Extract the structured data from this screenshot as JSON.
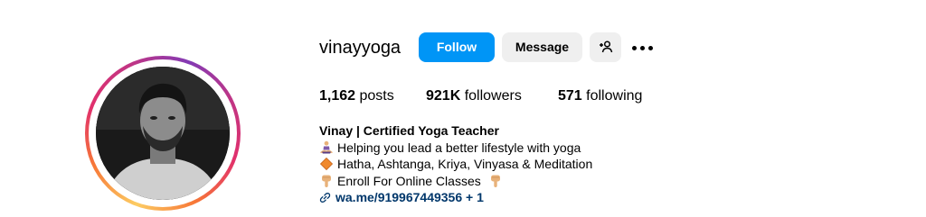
{
  "profile": {
    "username": "vinayyoga",
    "follow_label": "Follow",
    "message_label": "Message",
    "suggest_icon": "person-add-icon",
    "more_icon": "more-options-icon"
  },
  "stats": {
    "posts_count": "1,162",
    "posts_label": "posts",
    "followers_count": "921K",
    "followers_label": "followers",
    "following_count": "571",
    "following_label": "following"
  },
  "bio": {
    "name": "Vinay | Certified Yoga Teacher",
    "lines": [
      {
        "icon": "meditation-emoji",
        "text": "Helping you lead a better lifestyle with yoga"
      },
      {
        "icon": "orange-diamond-emoji",
        "text": "Hatha, Ashtanga, Kriya, Vinyasa & Meditation"
      },
      {
        "icon": "pointing-down-emoji",
        "text": "Enroll For Online Classes",
        "trailing_icon": "pointing-down-emoji"
      }
    ],
    "link_icon": "link-icon",
    "link_text": "wa.me/919967449356 + 1"
  },
  "colors": {
    "follow_button": "#0095f6",
    "secondary_button": "#efefef",
    "link": "#00376b"
  }
}
